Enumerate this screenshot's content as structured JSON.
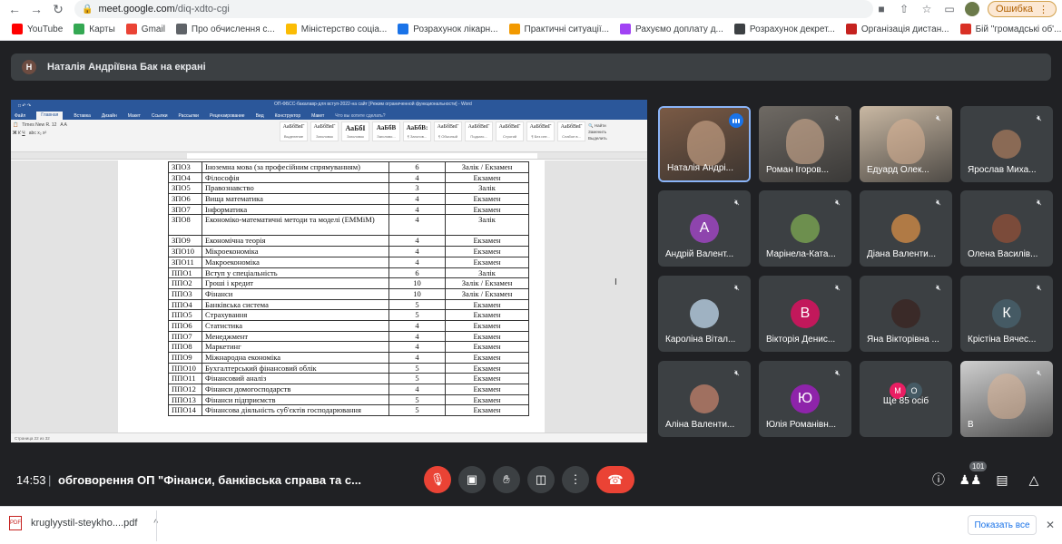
{
  "browser": {
    "url_host": "meet.google.com",
    "url_path": "/diq-xdto-cgi",
    "error_label": "Ошибка"
  },
  "bookmarks": [
    {
      "label": "YouTube",
      "color": "#ff0000"
    },
    {
      "label": "Карты",
      "color": "#34a853"
    },
    {
      "label": "Gmail",
      "color": "#ea4335"
    },
    {
      "label": "Про обчислення с...",
      "color": "#5f6368"
    },
    {
      "label": "Міністерство соціа...",
      "color": "#fbbc04"
    },
    {
      "label": "Розрахунок лікарн...",
      "color": "#1a73e8"
    },
    {
      "label": "Практичні ситуації...",
      "color": "#f29900"
    },
    {
      "label": "Рахуємо доплату д...",
      "color": "#a142f4"
    },
    {
      "label": "Розрахунок декрет...",
      "color": "#3c4043"
    },
    {
      "label": "Організація дистан...",
      "color": "#c5221f"
    },
    {
      "label": "Бій \"громадські об'...",
      "color": "#d93025"
    }
  ],
  "presenter": {
    "initial": "Н",
    "text": "Наталія Андріївна Бак на екрані"
  },
  "word": {
    "title_center": "ОП-ФБСС-бакалавр-для вступ-2022-на сайт [Режим ограниченной функциональности] - Word",
    "tabs": [
      "Файл",
      "Главная",
      "Вставка",
      "Дизайн",
      "Макет",
      "Ссылки",
      "Рассылки",
      "Рецензирование",
      "Вид",
      "Конструктор",
      "Макет"
    ],
    "search_hint": "Что вы хотите сделать?",
    "styles": [
      {
        "sample": "АаБбВвГ",
        "name": "Выделение"
      },
      {
        "sample": "АаБбВвГ",
        "name": "Заголовок"
      },
      {
        "sample": "АаБбІ",
        "name": "Заголовок"
      },
      {
        "sample": "АаБбВ",
        "name": "Заголово..."
      },
      {
        "sample": "АаБбВ:",
        "name": "¶ Заголов..."
      },
      {
        "sample": "АаБбВвГ",
        "name": "¶ Обычный"
      },
      {
        "sample": "АаБбВвГ",
        "name": "Подзаго..."
      },
      {
        "sample": "АаБбВвГ",
        "name": "Строгий"
      },
      {
        "sample": "АаБбВвГ",
        "name": "¶ Без инт..."
      },
      {
        "sample": "АаБбВвГ",
        "name": "Слабое в..."
      }
    ],
    "status": "Страница 22 из 32",
    "rows": [
      {
        "code": "ЗПО3",
        "name": "Іноземна мова (за професійним спрямуванням)",
        "credits": "6",
        "form": "Залік / Екзамен"
      },
      {
        "code": "ЗПО4",
        "name": "Філософія",
        "credits": "4",
        "form": "Екзамен"
      },
      {
        "code": "ЗПО5",
        "name": "Правознавство",
        "credits": "3",
        "form": "Залік"
      },
      {
        "code": "ЗПО6",
        "name": "Вища математика",
        "credits": "4",
        "form": "Екзамен"
      },
      {
        "code": "ЗПО7",
        "name": "Інформатика",
        "credits": "4",
        "form": "Екзамен"
      },
      {
        "code": "ЗПО8",
        "name": "Економіко-математичні методи та моделі (ЕММіМ)",
        "credits": "4",
        "form": "Залік",
        "tall": true
      },
      {
        "code": "ЗПО9",
        "name": "Економічна теорія",
        "credits": "4",
        "form": "Екзамен"
      },
      {
        "code": "ЗПО10",
        "name": "Мікроекономіка",
        "credits": "4",
        "form": "Екзамен"
      },
      {
        "code": "ЗПО11",
        "name": "Макроекономіка",
        "credits": "4",
        "form": "Екзамен"
      },
      {
        "code": "ППО1",
        "name": "Вступ у спеціальність",
        "credits": "6",
        "form": "Залік"
      },
      {
        "code": "ППО2",
        "name": "Гроші і кредит",
        "credits": "10",
        "form": "Залік / Екзамен"
      },
      {
        "code": "ППО3",
        "name": "Фінанси",
        "credits": "10",
        "form": "Залік / Екзамен"
      },
      {
        "code": "ППО4",
        "name": "Банківська система",
        "credits": "5",
        "form": "Екзамен"
      },
      {
        "code": "ППО5",
        "name": "Страхування",
        "credits": "5",
        "form": "Екзамен"
      },
      {
        "code": "ППО6",
        "name": "Статистика",
        "credits": "4",
        "form": "Екзамен"
      },
      {
        "code": "ППО7",
        "name": "Менеджмент",
        "credits": "4",
        "form": "Екзамен"
      },
      {
        "code": "ППО8",
        "name": "Маркетинг",
        "credits": "4",
        "form": "Екзамен"
      },
      {
        "code": "ППО9",
        "name": "Міжнародна економіка",
        "credits": "4",
        "form": "Екзамен"
      },
      {
        "code": "ППО10",
        "name": "Бухгалтерський фінансовий облік",
        "credits": "5",
        "form": "Екзамен"
      },
      {
        "code": "ППО11",
        "name": "Фінансовий аналіз",
        "credits": "5",
        "form": "Екзамен"
      },
      {
        "code": "ППО12",
        "name": "Фінанси домогосподарств",
        "credits": "4",
        "form": "Екзамен"
      },
      {
        "code": "ППО13",
        "name": "Фінанси підприємств",
        "credits": "5",
        "form": "Екзамен"
      },
      {
        "code": "ППО14",
        "name": "Фінансова діяльність суб'єктів господарювання",
        "credits": "5",
        "form": "Екзамен"
      }
    ]
  },
  "participants": [
    {
      "name": "Наталія Андрі...",
      "kind": "video",
      "bg": "#7a5a45",
      "active": true
    },
    {
      "name": "Роман Ігоров...",
      "kind": "video",
      "bg": "#6f6a64"
    },
    {
      "name": "Едуард Олек...",
      "kind": "video",
      "bg": "#c9b8a3"
    },
    {
      "name": "Ярослав Миха...",
      "kind": "photo",
      "color": "#8a6a55"
    },
    {
      "name": "Андрій Валент...",
      "kind": "letter",
      "letter": "А",
      "color": "#8e44ad"
    },
    {
      "name": "Марінела-Ката...",
      "kind": "photo",
      "color": "#6d8f4e"
    },
    {
      "name": "Діана Валенти...",
      "kind": "photo",
      "color": "#b07a45"
    },
    {
      "name": "Олена Василів...",
      "kind": "photo",
      "color": "#7b4b3a"
    },
    {
      "name": "Кароліна Вітал...",
      "kind": "photo",
      "color": "#9fb2c2"
    },
    {
      "name": "Вікторія Денис...",
      "kind": "letter",
      "letter": "В",
      "color": "#c2185b"
    },
    {
      "name": "Яна Вікторівна ...",
      "kind": "photo",
      "color": "#3a2a28"
    },
    {
      "name": "Крістіна Вячес...",
      "kind": "letter",
      "letter": "К",
      "color": "#455a64"
    },
    {
      "name": "Аліна Валенти...",
      "kind": "photo",
      "color": "#a07060"
    },
    {
      "name": "Юлія Романівн...",
      "kind": "letter",
      "letter": "Ю",
      "color": "#8e24aa"
    },
    {
      "name": "Ще 85 осіб",
      "kind": "more",
      "m1": "М",
      "m2": "О",
      "m1color": "#e91e63",
      "m2color": "#455a64"
    },
    {
      "name": "В",
      "kind": "video",
      "bg": "#cfcfcf"
    }
  ],
  "controls": {
    "time": "14:53",
    "meeting_title": "обговорення ОП \"Фінанси, банківська справа та с...",
    "people_count": "101"
  },
  "download": {
    "file_name": "kruglyystil-steykho....pdf",
    "show_all": "Показать все"
  }
}
